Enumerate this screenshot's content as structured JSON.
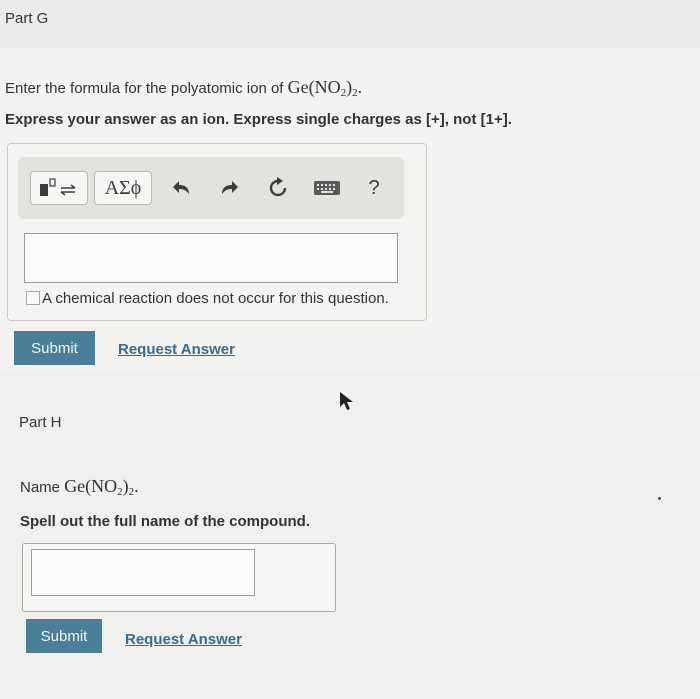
{
  "partG": {
    "title": "Part G",
    "prompt_prefix": "Enter the formula for the polyatomic ion of ",
    "formula": {
      "a": "Ge(NO",
      "sub": "2",
      "b": ")",
      "sub2": "2",
      "tail": "."
    },
    "instruction": "Express your answer as an ion. Express single charges as [+], not [1+].",
    "toolbar": {
      "template_icon": "template-icon",
      "greek_label": "ΑΣϕ",
      "undo_icon": "undo-arrow-icon",
      "redo_icon": "redo-arrow-icon",
      "reset_icon": "reset-icon",
      "keyboard_icon": "keyboard-icon",
      "help_label": "?"
    },
    "answer_value": "",
    "checkbox_label": "A chemical reaction does not occur for this question.",
    "submit_label": "Submit",
    "request_label": "Request Answer"
  },
  "partH": {
    "title": "Part H",
    "prompt_prefix": "Name ",
    "formula": {
      "a": "Ge(NO",
      "sub": "2",
      "b": ")",
      "sub2": "2",
      "tail": "."
    },
    "instruction": "Spell out the full name of the compound.",
    "answer_value": "",
    "submit_label": "Submit",
    "request_label": "Request Answer"
  },
  "colors": {
    "submit_bg": "#4b7f97",
    "link": "#3b6a8c",
    "text": "#333333"
  }
}
